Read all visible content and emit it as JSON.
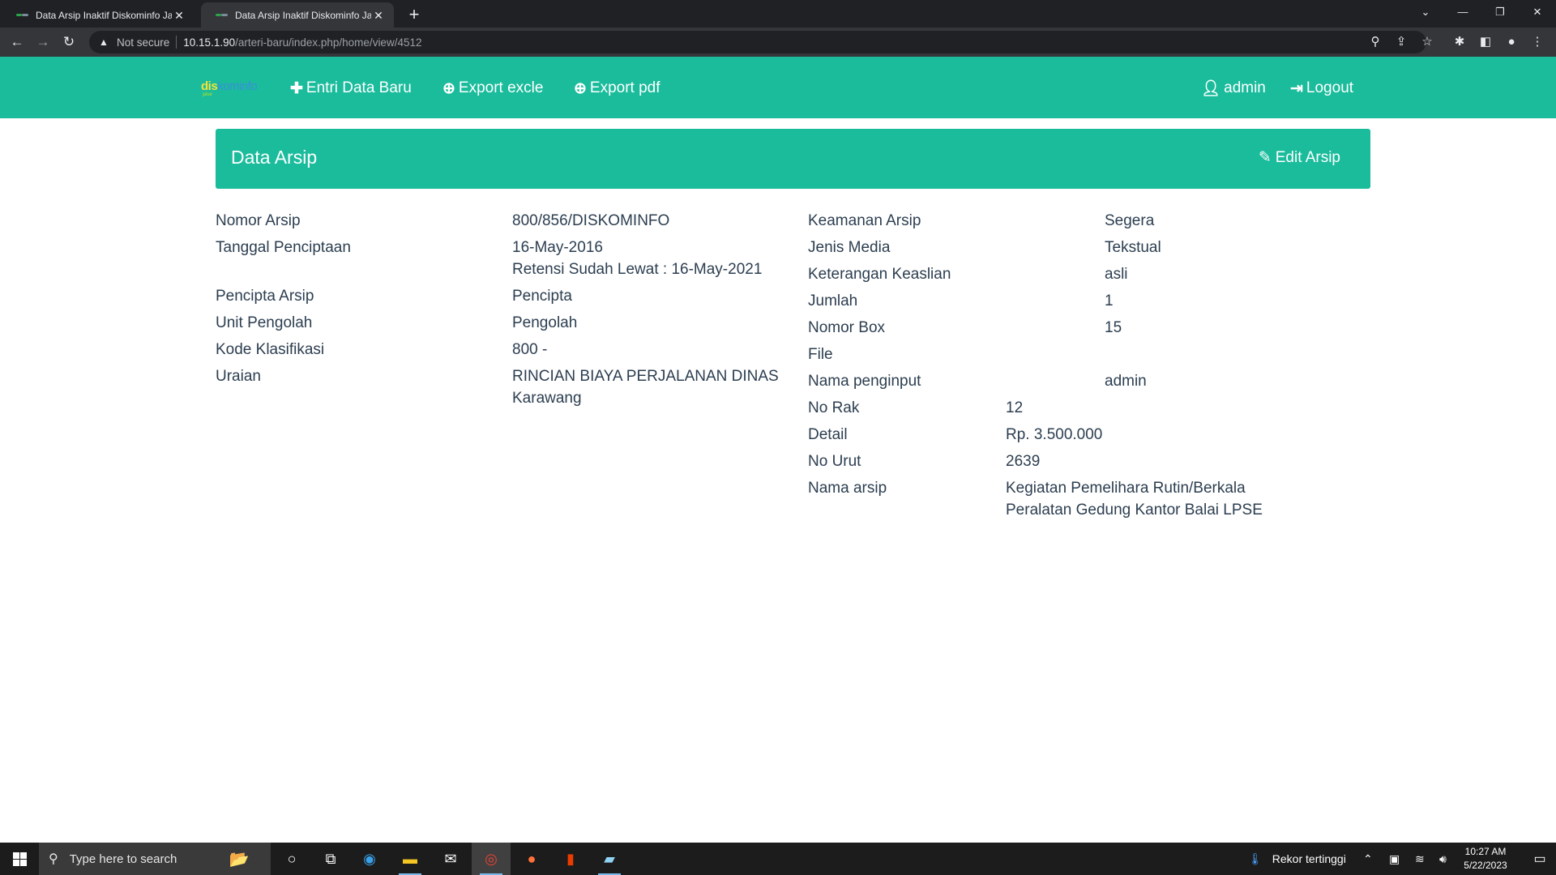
{
  "browser": {
    "tabs": [
      {
        "title": "Data Arsip Inaktif Diskominfo Jaw",
        "active": false
      },
      {
        "title": "Data Arsip Inaktif Diskominfo Jaw",
        "active": true
      }
    ],
    "new_tab": "+",
    "security_label": "Not secure",
    "url_host": "10.15.1.90",
    "url_path": "/arteri-baru/index.php/home/view/4512"
  },
  "navbar": {
    "logo_text_a": "dis",
    "logo_text_b": "kominfo",
    "logo_sub": "jabar",
    "entri_label": "Entri Data Baru",
    "export_excel_label": "Export excle",
    "export_pdf_label": "Export pdf",
    "user_label": "admin",
    "logout_label": "Logout"
  },
  "panel": {
    "title": "Data Arsip",
    "edit_label": "Edit Arsip"
  },
  "left_fields": {
    "nomor_arsip": {
      "label": "Nomor Arsip",
      "value": "800/856/DISKOMINFO"
    },
    "tanggal_penciptaan": {
      "label": "Tanggal Penciptaan",
      "value": "16-May-2016",
      "retensi": "Retensi Sudah Lewat : 16-May-2021"
    },
    "pencipta_arsip": {
      "label": "Pencipta Arsip",
      "value": "Pencipta"
    },
    "unit_pengolah": {
      "label": "Unit Pengolah",
      "value": "Pengolah"
    },
    "kode_klasifikasi": {
      "label": "Kode Klasifikasi",
      "value": "800 -"
    },
    "uraian": {
      "label": "Uraian",
      "value": "RINCIAN BIAYA PERJALANAN DINAS Karawang"
    }
  },
  "right_fields": {
    "keamanan_arsip": {
      "label": "Keamanan Arsip",
      "value": "Segera"
    },
    "jenis_media": {
      "label": "Jenis Media",
      "value": "Tekstual"
    },
    "keterangan_keaslian": {
      "label": "Keterangan Keaslian",
      "value": "asli"
    },
    "jumlah": {
      "label": "Jumlah",
      "value": "1"
    },
    "nomor_box": {
      "label": "Nomor Box",
      "value": "15"
    },
    "file": {
      "label": "File",
      "value": ""
    },
    "nama_penginput": {
      "label": "Nama penginput",
      "value": "admin"
    },
    "no_rak": {
      "label": "No Rak",
      "value": "12"
    },
    "detail": {
      "label": "Detail",
      "value": "Rp. 3.500.000"
    },
    "no_urut": {
      "label": "No Urut",
      "value": "2639"
    },
    "nama_arsip": {
      "label": "Nama arsip",
      "value": "Kegiatan Pemelihara Rutin/Berkala Peralatan Gedung Kantor Balai LPSE"
    }
  },
  "taskbar": {
    "search_placeholder": "Type here to search",
    "weather_label": "Rekor tertinggi",
    "time": "10:27 AM",
    "date": "5/22/2023"
  }
}
